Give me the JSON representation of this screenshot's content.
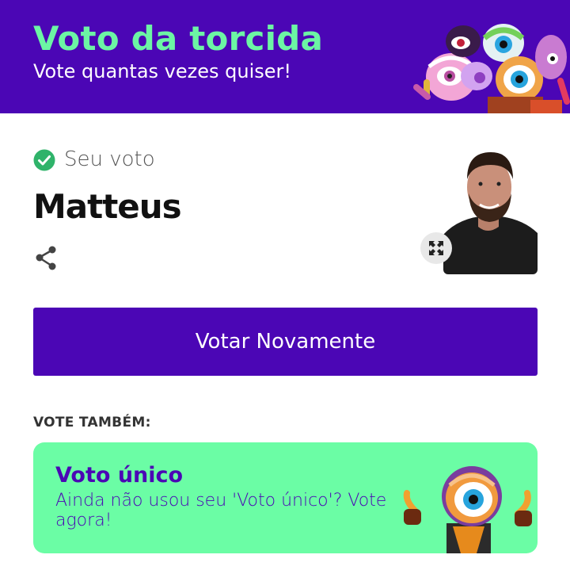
{
  "header": {
    "title": "Voto da torcida",
    "subtitle": "Vote quantas vezes quiser!"
  },
  "vote": {
    "label": "Seu voto",
    "candidate": "Matteus"
  },
  "actions": {
    "vote_again": "Votar Novamente"
  },
  "vote_also": {
    "label": "VOTE TAMBÉM:",
    "card": {
      "title": "Voto único",
      "description": "Ainda não usou seu 'Voto único'? Vote agora!"
    }
  },
  "colors": {
    "brand_purple": "#4b06b5",
    "brand_green": "#6bfda5"
  },
  "icons": {
    "check": "check-circle-icon",
    "share": "share-icon",
    "expand": "expand-icon"
  }
}
